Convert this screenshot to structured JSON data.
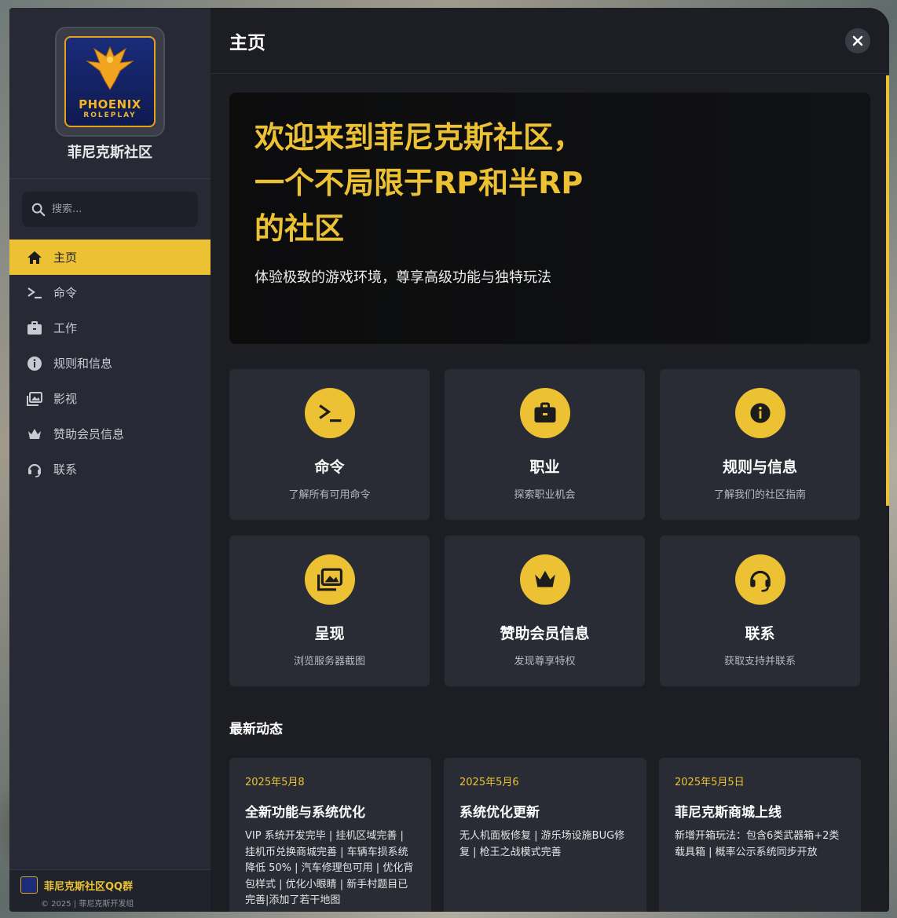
{
  "brand": {
    "logo_text": "PHOENIX",
    "logo_sub": "ROLEPLAY",
    "name": "菲尼克斯社区"
  },
  "search": {
    "placeholder": "搜索..."
  },
  "sidebar": {
    "items": [
      {
        "label": "主页",
        "icon": "home-icon",
        "active": true
      },
      {
        "label": "命令",
        "icon": "terminal-icon"
      },
      {
        "label": "工作",
        "icon": "briefcase-icon"
      },
      {
        "label": "规则和信息",
        "icon": "info-icon"
      },
      {
        "label": "影视",
        "icon": "images-icon"
      },
      {
        "label": "赞助会员信息",
        "icon": "crown-icon"
      },
      {
        "label": "联系",
        "icon": "headset-icon"
      }
    ],
    "footer": {
      "qq_title": "菲尼克斯社区QQ群",
      "copyright": "© 2025 | 菲尼克斯开发组"
    }
  },
  "header": {
    "title": "主页",
    "close_icon": "close-icon"
  },
  "hero": {
    "title": "欢迎来到菲尼克斯社区，一个不局限于RP和半RP的社区",
    "subtitle": "体验极致的游戏环境，尊享高级功能与独特玩法"
  },
  "cards": [
    {
      "title": "命令",
      "desc": "了解所有可用命令",
      "icon": "terminal-icon"
    },
    {
      "title": "职业",
      "desc": "探索职业机会",
      "icon": "briefcase-icon"
    },
    {
      "title": "规则与信息",
      "desc": "了解我们的社区指南",
      "icon": "info-icon"
    },
    {
      "title": "呈现",
      "desc": "浏览服务器截图",
      "icon": "images-icon"
    },
    {
      "title": "赞助会员信息",
      "desc": "发现尊享特权",
      "icon": "crown-icon"
    },
    {
      "title": "联系",
      "desc": "获取支持并联系",
      "icon": "headset-icon"
    }
  ],
  "news": {
    "section_title": "最新动态",
    "items": [
      {
        "date": "2025年5月8",
        "title": "全新功能与系统优化",
        "body": "VIP 系统开发完毕 | 挂机区域完善 | 挂机币兑换商城完善 | 车辆车损系统降低 50% | 汽车修理包可用 | 优化背包样式 | 优化小眼睛 | 新手村题目已完善|添加了若干地图"
      },
      {
        "date": "2025年5月6",
        "title": "系统优化更新",
        "body": "无人机面板修复 | 游乐场设施BUG修复 | 枪王之战模式完善"
      },
      {
        "date": "2025年5月5日",
        "title": "菲尼克斯商城上线",
        "body": "新增开箱玩法：包含6类武器箱+2类载具箱 | 概率公示系统同步开放"
      }
    ]
  },
  "colors": {
    "accent": "#ecc234",
    "sidebar_bg": "#272a35",
    "main_bg": "#1c1e24",
    "card_bg": "#292c35"
  }
}
